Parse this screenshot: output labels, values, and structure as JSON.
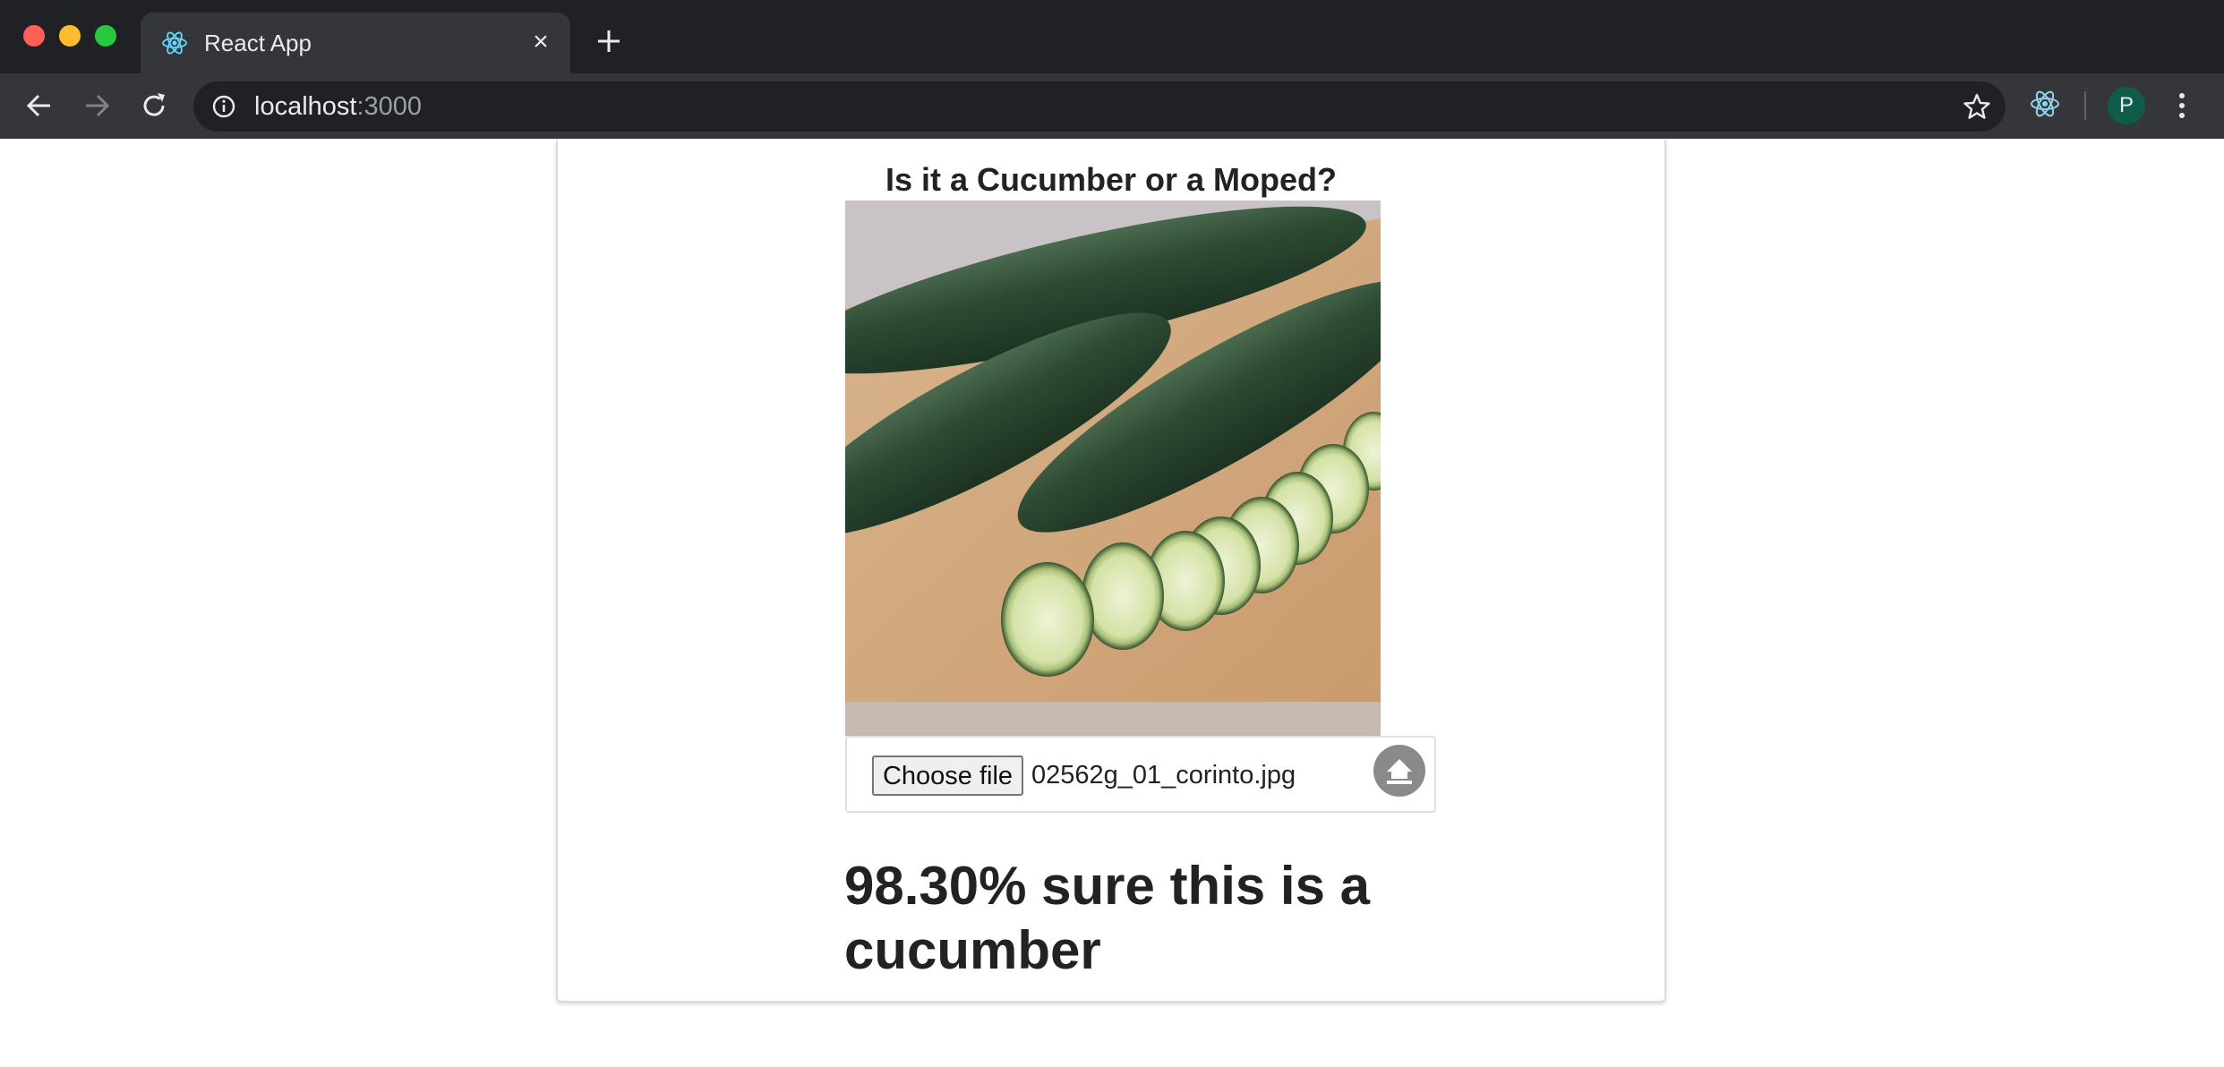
{
  "browser": {
    "tab": {
      "title": "React App",
      "favicon": "react-logo-icon",
      "close": "×"
    },
    "new_tab_icon": "plus-icon",
    "address": {
      "host": "localhost",
      "port": ":3000"
    },
    "profile_initial": "P"
  },
  "page": {
    "title": "Is it a Cucumber or a Moped?",
    "image_alt": "cucumbers on a cutting board",
    "file_input": {
      "button_label": "Choose file",
      "file_name": "02562g_01_corinto.jpg"
    },
    "upload_icon": "upload-icon",
    "result_text": "98.30% sure this is a cucumber"
  },
  "colors": {
    "titlebar": "#202124",
    "toolbar": "#35363a",
    "accent_react": "#61dafb",
    "avatar": "#0f5c4a"
  }
}
